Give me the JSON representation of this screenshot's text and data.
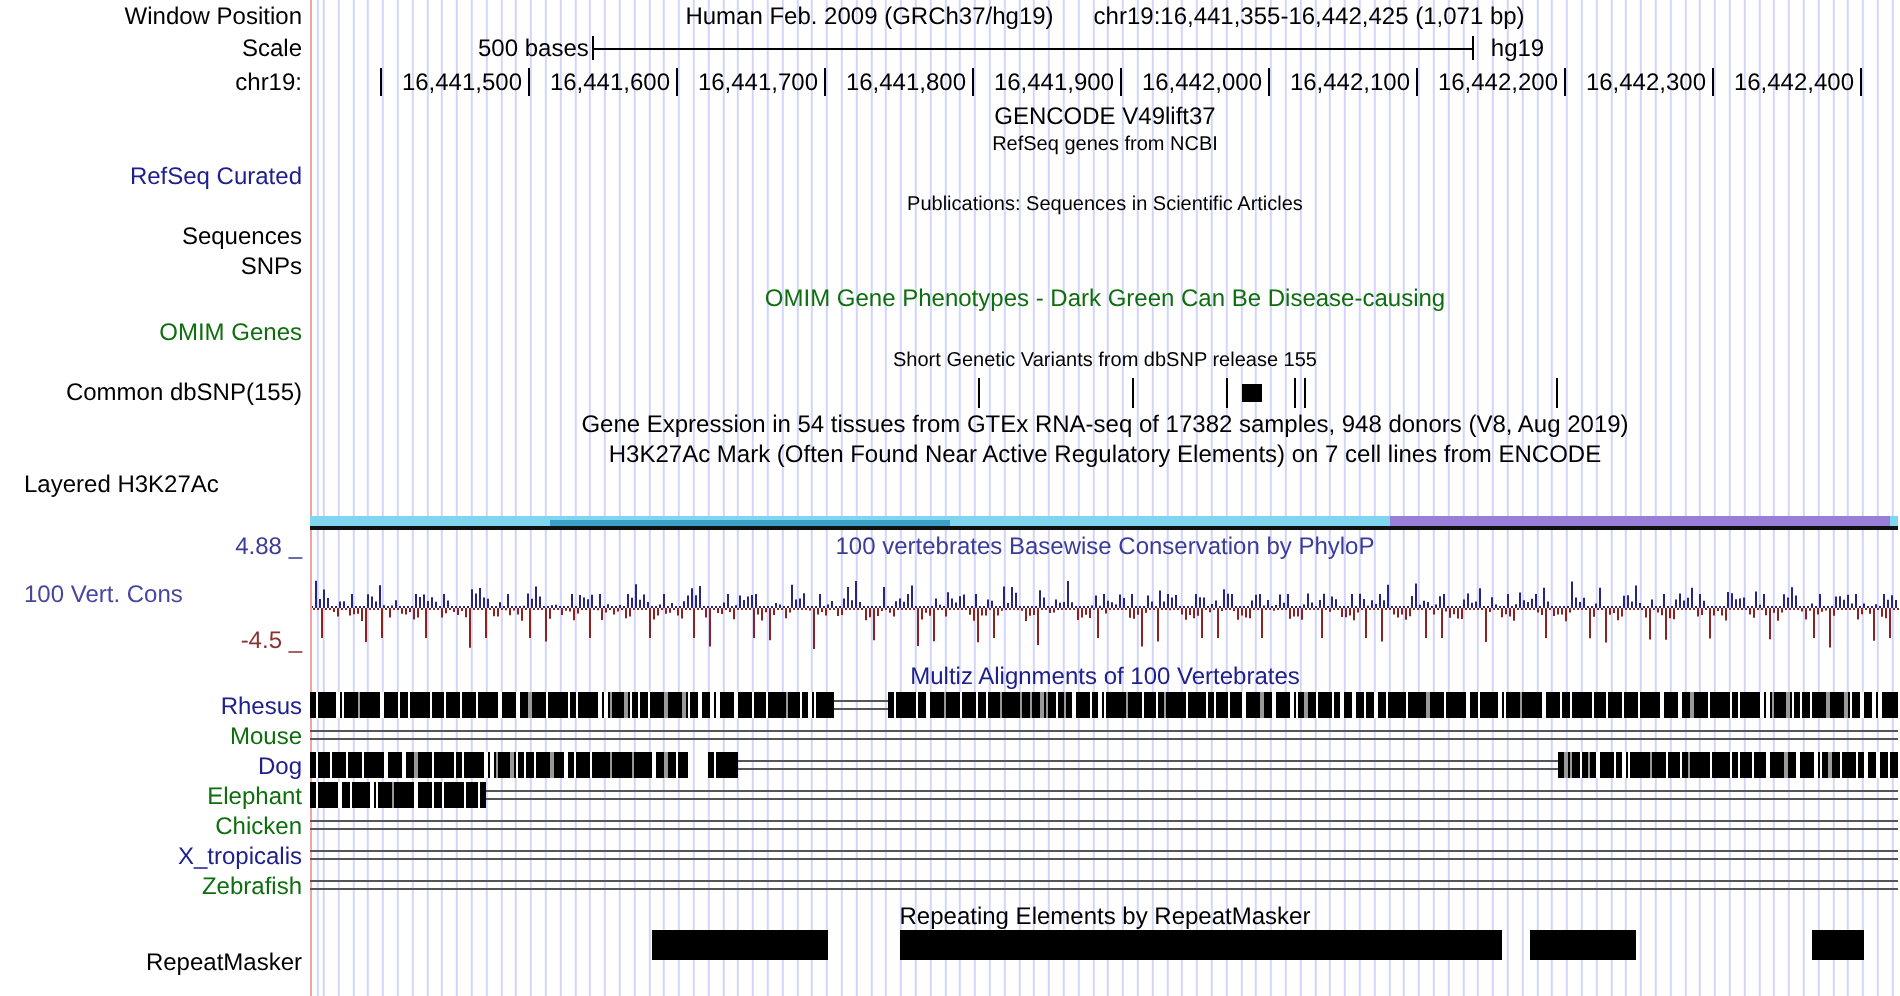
{
  "rows": [
    {
      "kind": "position",
      "label": "Window Position",
      "assembly_text": "Human Feb. 2009 (GRCh37/hg19)",
      "range_text": "chr19:16,441,355-16,442,425 (1,071 bp)"
    },
    {
      "kind": "scale",
      "label": "Scale",
      "text": "500 bases",
      "assembly": "hg19"
    },
    {
      "kind": "ruler",
      "label": "chr19:",
      "ticks": [
        "16,441,500",
        "16,441,600",
        "16,441,700",
        "16,441,800",
        "16,441,900",
        "16,442,000",
        "16,442,100",
        "16,442,200",
        "16,442,300",
        "16,442,400"
      ]
    },
    {
      "kind": "title",
      "text": "GENCODE V49lift37",
      "color": "#000000"
    },
    {
      "kind": "caption",
      "text": "RefSeq genes from NCBI"
    },
    {
      "kind": "label",
      "label": "RefSeq Curated",
      "color": "#20208c"
    },
    {
      "kind": "caption",
      "text": "Publications: Sequences in Scientific Articles"
    },
    {
      "kind": "label",
      "label": "Sequences",
      "color": "#000000"
    },
    {
      "kind": "label",
      "label": "SNPs",
      "color": "#000000"
    },
    {
      "kind": "title",
      "text": "OMIM Gene Phenotypes - Dark Green Can Be Disease-causing",
      "color": "#0e6e0e"
    },
    {
      "kind": "label",
      "label": "OMIM Genes",
      "color": "#0e6e0e"
    },
    {
      "kind": "caption",
      "text": "Short Genetic Variants from dbSNP release 155"
    },
    {
      "kind": "dbsnp",
      "label": "Common dbSNP(155)"
    },
    {
      "kind": "title",
      "text": "Gene Expression in 54 tissues from GTEx RNA-seq of 17382 samples, 948 donors (V8, Aug 2019)",
      "color": "#000000"
    },
    {
      "kind": "title",
      "text": "H3K27Ac Mark (Often Found Near Active Regulatory Elements) on 7 cell lines from ENCODE",
      "color": "#000000"
    },
    {
      "kind": "composite_label",
      "label": "Layered H3K27Ac"
    },
    {
      "kind": "layered"
    },
    {
      "kind": "wiggle",
      "top": "4.88 _",
      "label": "100 Vert. Cons",
      "bottom": "-4.5 _",
      "text": "100 vertebrates Basewise Conservation by PhyloP"
    },
    {
      "kind": "title",
      "text": "Multiz Alignments of 100 Vertebrates",
      "color": "#20208c"
    },
    {
      "kind": "species",
      "label": "Rhesus",
      "color": "#20208c"
    },
    {
      "kind": "species",
      "label": "Mouse",
      "color": "#0e6e0e"
    },
    {
      "kind": "species",
      "label": "Dog",
      "color": "#20208c"
    },
    {
      "kind": "species",
      "label": "Elephant",
      "color": "#0e6e0e"
    },
    {
      "kind": "species",
      "label": "Chicken",
      "color": "#0e6e0e"
    },
    {
      "kind": "species",
      "label": "X_tropicalis",
      "color": "#20208c"
    },
    {
      "kind": "species",
      "label": "Zebrafish",
      "color": "#0e6e0e"
    },
    {
      "kind": "title",
      "text": "Repeating Elements by RepeatMasker",
      "color": "#000000"
    },
    {
      "kind": "repeat",
      "label": "RepeatMasker"
    }
  ]
}
